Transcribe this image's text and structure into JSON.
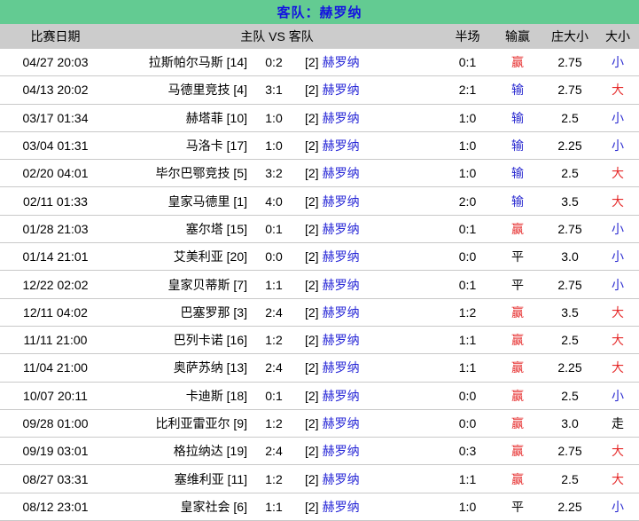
{
  "title": {
    "label": "客队：赫罗纳"
  },
  "colors": {
    "title_bg": "#63cb92",
    "title_text": "#1414e0",
    "header_bg": "#cccccc",
    "row_divider": "#c9c9c9",
    "red": "#e62b2b",
    "blue": "#2b2bd0",
    "link_blue": "#2424d6"
  },
  "table": {
    "headers": {
      "date": "比赛日期",
      "matchup": "主队 VS 客队",
      "half": "半场",
      "win_loss": "输赢",
      "banker_total": "庄大小",
      "total": "大小"
    },
    "away_team": "赫罗纳",
    "rows": [
      {
        "date": "04/27 20:03",
        "home": "拉斯帕尔马斯 [14]",
        "score": "0:2",
        "away_rank": "[2]",
        "away": "赫罗纳",
        "half": "0:1",
        "result": "赢",
        "result_color": "red",
        "odds": "2.75",
        "total": "小",
        "total_color": "blue"
      },
      {
        "date": "04/13 20:02",
        "home": "马德里竞技 [4]",
        "score": "3:1",
        "away_rank": "[2]",
        "away": "赫罗纳",
        "half": "2:1",
        "result": "输",
        "result_color": "blue",
        "odds": "2.75",
        "total": "大",
        "total_color": "red"
      },
      {
        "date": "03/17 01:34",
        "home": "赫塔菲 [10]",
        "score": "1:0",
        "away_rank": "[2]",
        "away": "赫罗纳",
        "half": "1:0",
        "result": "输",
        "result_color": "blue",
        "odds": "2.5",
        "total": "小",
        "total_color": "blue"
      },
      {
        "date": "03/04 01:31",
        "home": "马洛卡 [17]",
        "score": "1:0",
        "away_rank": "[2]",
        "away": "赫罗纳",
        "half": "1:0",
        "result": "输",
        "result_color": "blue",
        "odds": "2.25",
        "total": "小",
        "total_color": "blue"
      },
      {
        "date": "02/20 04:01",
        "home": "毕尔巴鄂竞技 [5]",
        "score": "3:2",
        "away_rank": "[2]",
        "away": "赫罗纳",
        "half": "1:0",
        "result": "输",
        "result_color": "blue",
        "odds": "2.5",
        "total": "大",
        "total_color": "red"
      },
      {
        "date": "02/11 01:33",
        "home": "皇家马德里 [1]",
        "score": "4:0",
        "away_rank": "[2]",
        "away": "赫罗纳",
        "half": "2:0",
        "result": "输",
        "result_color": "blue",
        "odds": "3.5",
        "total": "大",
        "total_color": "red"
      },
      {
        "date": "01/28 21:03",
        "home": "塞尔塔 [15]",
        "score": "0:1",
        "away_rank": "[2]",
        "away": "赫罗纳",
        "half": "0:1",
        "result": "赢",
        "result_color": "red",
        "odds": "2.75",
        "total": "小",
        "total_color": "blue"
      },
      {
        "date": "01/14 21:01",
        "home": "艾美利亚 [20]",
        "score": "0:0",
        "away_rank": "[2]",
        "away": "赫罗纳",
        "half": "0:0",
        "result": "平",
        "result_color": "black",
        "odds": "3.0",
        "total": "小",
        "total_color": "blue"
      },
      {
        "date": "12/22 02:02",
        "home": "皇家贝蒂斯 [7]",
        "score": "1:1",
        "away_rank": "[2]",
        "away": "赫罗纳",
        "half": "0:1",
        "result": "平",
        "result_color": "black",
        "odds": "2.75",
        "total": "小",
        "total_color": "blue"
      },
      {
        "date": "12/11 04:02",
        "home": "巴塞罗那 [3]",
        "score": "2:4",
        "away_rank": "[2]",
        "away": "赫罗纳",
        "half": "1:2",
        "result": "赢",
        "result_color": "red",
        "odds": "3.5",
        "total": "大",
        "total_color": "red"
      },
      {
        "date": "11/11 21:00",
        "home": "巴列卡诺 [16]",
        "score": "1:2",
        "away_rank": "[2]",
        "away": "赫罗纳",
        "half": "1:1",
        "result": "赢",
        "result_color": "red",
        "odds": "2.5",
        "total": "大",
        "total_color": "red"
      },
      {
        "date": "11/04 21:00",
        "home": "奥萨苏纳 [13]",
        "score": "2:4",
        "away_rank": "[2]",
        "away": "赫罗纳",
        "half": "1:1",
        "result": "赢",
        "result_color": "red",
        "odds": "2.25",
        "total": "大",
        "total_color": "red"
      },
      {
        "date": "10/07 20:11",
        "home": "卡迪斯 [18]",
        "score": "0:1",
        "away_rank": "[2]",
        "away": "赫罗纳",
        "half": "0:0",
        "result": "赢",
        "result_color": "red",
        "odds": "2.5",
        "total": "小",
        "total_color": "blue"
      },
      {
        "date": "09/28 01:00",
        "home": "比利亚雷亚尔 [9]",
        "score": "1:2",
        "away_rank": "[2]",
        "away": "赫罗纳",
        "half": "0:0",
        "result": "赢",
        "result_color": "red",
        "odds": "3.0",
        "total": "走",
        "total_color": "black"
      },
      {
        "date": "09/19 03:01",
        "home": "格拉纳达 [19]",
        "score": "2:4",
        "away_rank": "[2]",
        "away": "赫罗纳",
        "half": "0:3",
        "result": "赢",
        "result_color": "red",
        "odds": "2.75",
        "total": "大",
        "total_color": "red"
      },
      {
        "date": "08/27 03:31",
        "home": "塞维利亚 [11]",
        "score": "1:2",
        "away_rank": "[2]",
        "away": "赫罗纳",
        "half": "1:1",
        "result": "赢",
        "result_color": "red",
        "odds": "2.5",
        "total": "大",
        "total_color": "red"
      },
      {
        "date": "08/12 23:01",
        "home": "皇家社会 [6]",
        "score": "1:1",
        "away_rank": "[2]",
        "away": "赫罗纳",
        "half": "1:0",
        "result": "平",
        "result_color": "black",
        "odds": "2.25",
        "total": "小",
        "total_color": "blue"
      }
    ]
  }
}
